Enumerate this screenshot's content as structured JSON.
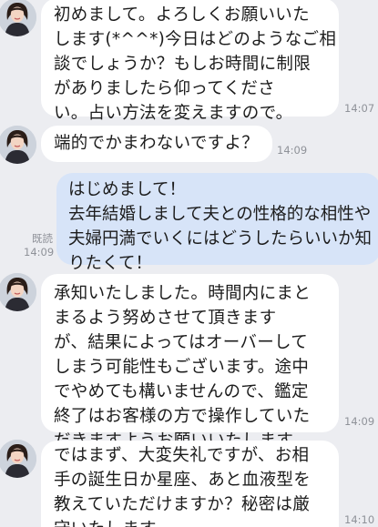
{
  "conversation": {
    "messages": [
      {
        "side": "incoming",
        "text": "初めまして。よろしくお願いいた\nします(*^^*)今日はどのようなご相\n談でしょうか？もしお時間に制限\nがありましたら仰ってくださ\nい。占い方法を変えますので。",
        "time": "14:07"
      },
      {
        "side": "incoming",
        "text": "端的でかまわないですよ？",
        "time": "14:09"
      },
      {
        "side": "outgoing",
        "text": "はじめまして！\n去年結婚しまして夫との性格的な相性や\n夫婦円満でいくにはどうしたらいいか知\nりたくて！",
        "read_label": "既読",
        "time": "14:09"
      },
      {
        "side": "incoming",
        "text": "承知いたしました。時間内にまと\nまるよう努めさせて頂きます\nが、結果によってはオーバーして\nしまう可能性もございます。途中\nでやめても構いませんので、鑑定\n終了はお客様の方で操作していた\nだきますようお願いいたします。",
        "time": "14:09"
      },
      {
        "side": "incoming",
        "text": "ではまず、大変失礼ですが、お相\n手の誕生日か星座、あと血液型を\n教えていただけますか？秘密は厳\n守いたします。",
        "time": "14:10"
      }
    ]
  },
  "icons": {
    "avatar": "profile-photo-icon"
  },
  "colors": {
    "background": "#ecedf1",
    "incoming_bubble": "#ffffff",
    "outgoing_bubble": "#d7e4f8",
    "meta_text": "#8f9299"
  }
}
